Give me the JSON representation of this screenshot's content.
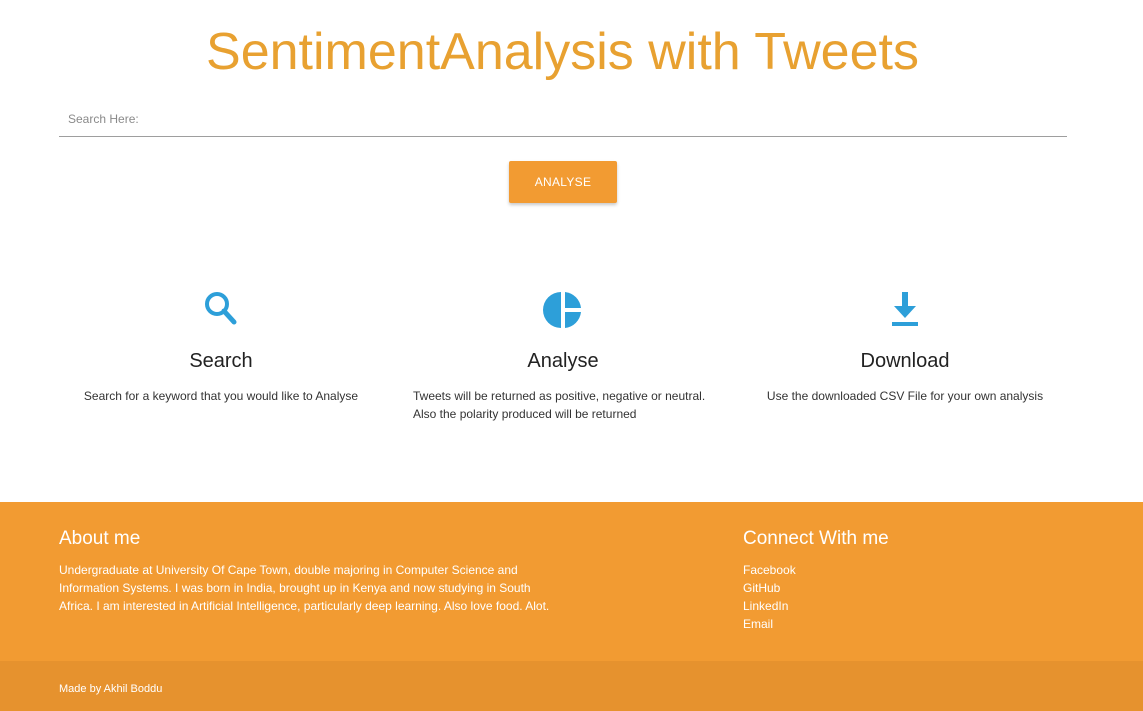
{
  "header": {
    "title": "SentimentAnalysis with Tweets"
  },
  "search": {
    "placeholder": "Search Here:",
    "value": ""
  },
  "actions": {
    "analyse_label": "ANALYSE"
  },
  "features": [
    {
      "icon": "search-icon",
      "title": "Search",
      "description": "Search for a keyword that you would like to Analyse"
    },
    {
      "icon": "pie-chart-icon",
      "title": "Analyse",
      "description_line1": "Tweets will be returned as positive, negative or neutral.",
      "description_line2": "Also the polarity produced will be returned"
    },
    {
      "icon": "download-icon",
      "title": "Download",
      "description": "Use the downloaded CSV File for your own analysis"
    }
  ],
  "footer": {
    "about_title": "About me",
    "about_text": "Undergraduate at University Of Cape Town, double majoring in Computer Science and Information Systems. I was born in India, brought up in Kenya and now studying in South Africa. I am interested in Artificial Intelligence, particularly deep learning. Also love food. Alot.",
    "connect_title": "Connect With me",
    "links": [
      "Facebook",
      "GitHub",
      "LinkedIn",
      "Email"
    ],
    "credit": "Made by Akhil Boddu"
  },
  "colors": {
    "accent": "#f29b32",
    "title": "#e8a131",
    "icon": "#2d9fd9",
    "footer_bottom": "#e6922e"
  }
}
